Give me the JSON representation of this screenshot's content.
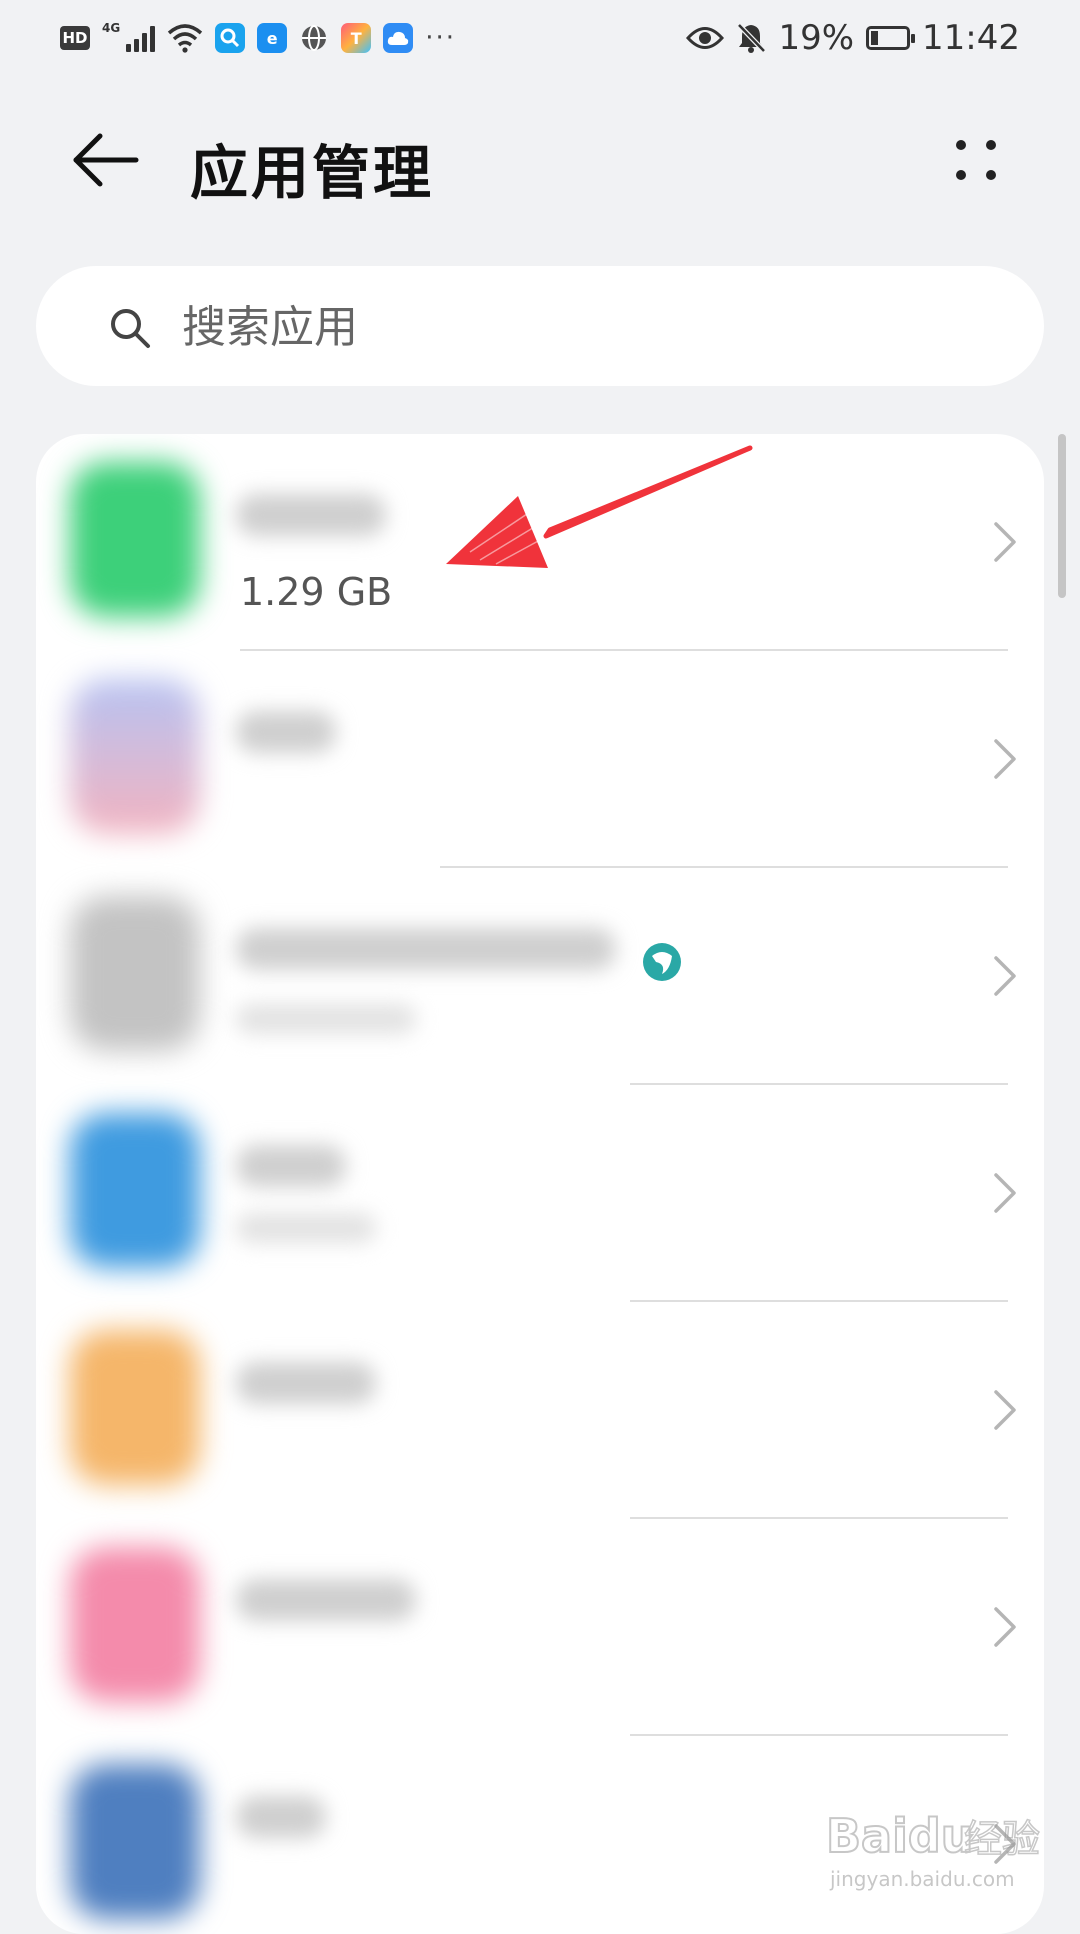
{
  "status_bar": {
    "hd": "HD",
    "network": "4G",
    "battery": "19%",
    "time": "11:42",
    "overflow": "···"
  },
  "header": {
    "title": "应用管理"
  },
  "search": {
    "placeholder": "搜索应用"
  },
  "apps": [
    {
      "size": "1.29 GB",
      "icon_color": "#3dd07a"
    },
    {
      "size": "",
      "icon_color": "#b9b6e8"
    },
    {
      "size": "",
      "icon_color": "#bdbdbd"
    },
    {
      "size": "",
      "icon_color": "#3f9be0"
    },
    {
      "size": "",
      "icon_color": "#f5b66a"
    },
    {
      "size": "",
      "icon_color": "#f48bab"
    },
    {
      "size": "",
      "icon_color": "#4f7fc0"
    }
  ],
  "colors": {
    "background": "#f1f2f4",
    "card": "#ffffff",
    "annotation_arrow": "#f0333b",
    "badge": "#2aa8a6"
  },
  "icons": {
    "back": "arrow-left-icon",
    "more": "four-dots-icon",
    "search": "magnifier-icon",
    "chevron": "chevron-right-icon"
  }
}
